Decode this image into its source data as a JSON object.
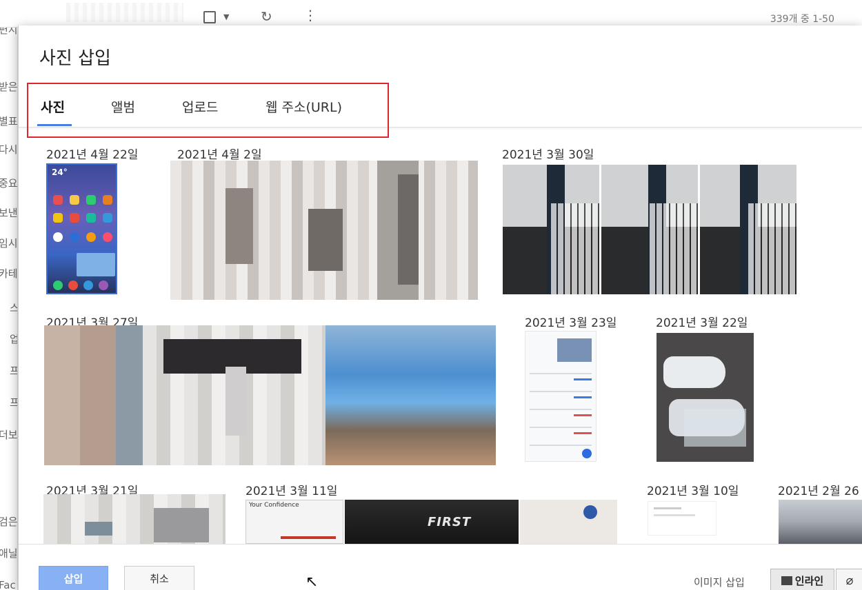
{
  "background": {
    "count_text": "339개 중 1-50",
    "left_labels": [
      "편지쓰",
      "받은",
      "별표",
      "다시",
      "중요",
      "보낸",
      "임시",
      "카테",
      "스",
      "업",
      "프",
      "프",
      "더보",
      "검은",
      "애닐",
      "Fac"
    ]
  },
  "dialog": {
    "title": "사진 삽입",
    "tabs": [
      {
        "label": "사진",
        "active": true
      },
      {
        "label": "앨범",
        "active": false
      },
      {
        "label": "업로드",
        "active": false
      },
      {
        "label": "웹 주소(URL)",
        "active": false
      }
    ],
    "dates": [
      "2021년 4월 22일",
      "2021년 4월 2일",
      "2021년 3월 30일",
      "2021년 3월 27일",
      "2021년 3월 23일",
      "2021년 3월 22일",
      "2021년 3월 21일",
      "2021년 3월 11일",
      "2021년 3월 10일",
      "2021년 2월 26"
    ],
    "phone_clock": "24°",
    "ppt_text": "Your Confidence",
    "monitor_text": "FIRST"
  },
  "footer": {
    "insert_label": "삽입",
    "cancel_label": "취소",
    "insert_image_label": "이미지 삽입",
    "inline_label": "인라인"
  },
  "colors": {
    "accent": "#4a7fe0",
    "highlight": "#e0242e",
    "insert_button": "#88b1f3"
  }
}
